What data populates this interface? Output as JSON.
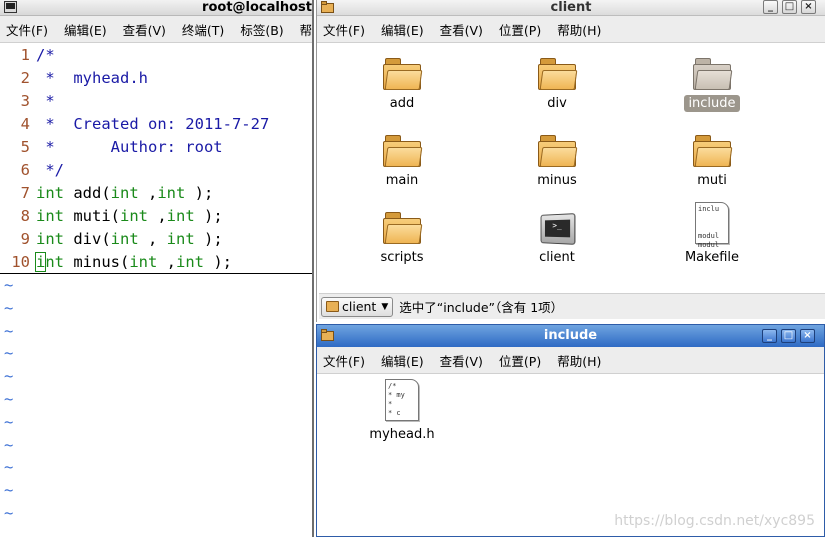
{
  "terminal": {
    "title": "root@localhost",
    "menu": [
      "文件(F)",
      "编辑(E)",
      "查看(V)",
      "终端(T)",
      "标签(B)",
      "帮助"
    ],
    "lines": [
      {
        "num": "1",
        "parts": [
          {
            "c": "cm",
            "t": "/*"
          }
        ]
      },
      {
        "num": "2",
        "parts": [
          {
            "c": "cm",
            "t": " *  myhead.h"
          }
        ]
      },
      {
        "num": "3",
        "parts": [
          {
            "c": "cm",
            "t": " *"
          }
        ]
      },
      {
        "num": "4",
        "parts": [
          {
            "c": "cm",
            "t": " *  Created on: 2011-7-27"
          }
        ]
      },
      {
        "num": "5",
        "parts": [
          {
            "c": "cm",
            "t": " *      Author: root"
          }
        ]
      },
      {
        "num": "6",
        "parts": [
          {
            "c": "cm",
            "t": " */"
          }
        ]
      },
      {
        "num": "7",
        "parts": [
          {
            "c": "kw",
            "t": "int"
          },
          {
            "c": "tx",
            "t": " add("
          },
          {
            "c": "kw",
            "t": "int"
          },
          {
            "c": "tx",
            "t": " ,"
          },
          {
            "c": "kw",
            "t": "int"
          },
          {
            "c": "tx",
            "t": " );"
          }
        ]
      },
      {
        "num": "8",
        "parts": [
          {
            "c": "kw",
            "t": "int"
          },
          {
            "c": "tx",
            "t": " muti("
          },
          {
            "c": "kw",
            "t": "int"
          },
          {
            "c": "tx",
            "t": " ,"
          },
          {
            "c": "kw",
            "t": "int"
          },
          {
            "c": "tx",
            "t": " );"
          }
        ]
      },
      {
        "num": "9",
        "parts": [
          {
            "c": "kw",
            "t": "int"
          },
          {
            "c": "tx",
            "t": " div("
          },
          {
            "c": "kw",
            "t": "int"
          },
          {
            "c": "tx",
            "t": " , "
          },
          {
            "c": "kw",
            "t": "int"
          },
          {
            "c": "tx",
            "t": " );"
          }
        ]
      },
      {
        "num": "10",
        "parts": [
          {
            "c": "kw",
            "t": "int"
          },
          {
            "c": "tx",
            "t": " minus("
          },
          {
            "c": "kw",
            "t": "int"
          },
          {
            "c": "tx",
            "t": " ,"
          },
          {
            "c": "kw",
            "t": "int"
          },
          {
            "c": "tx",
            "t": " );"
          }
        ]
      }
    ],
    "tilde_count": 11,
    "tilde_char": "~"
  },
  "client": {
    "title": "client",
    "menu": [
      "文件(F)",
      "编辑(E)",
      "查看(V)",
      "位置(P)",
      "帮助(H)"
    ],
    "items": [
      {
        "label": "add",
        "kind": "folder"
      },
      {
        "label": "div",
        "kind": "folder"
      },
      {
        "label": "include",
        "kind": "folder",
        "selected": true
      },
      {
        "label": "main",
        "kind": "folder"
      },
      {
        "label": "minus",
        "kind": "folder"
      },
      {
        "label": "muti",
        "kind": "folder"
      },
      {
        "label": "scripts",
        "kind": "folder"
      },
      {
        "label": "client",
        "kind": "executable"
      },
      {
        "label": "Makefile",
        "kind": "text",
        "preview": [
          "inclu",
          "",
          "",
          "modul",
          "modul"
        ]
      }
    ],
    "path_button": "client",
    "status": "选中了“include”（含有 1项）"
  },
  "include": {
    "title": "include",
    "menu": [
      "文件(F)",
      "编辑(E)",
      "查看(V)",
      "位置(P)",
      "帮助(H)"
    ],
    "items": [
      {
        "label": "myhead.h",
        "kind": "text",
        "preview": [
          "/*",
          " * my",
          " *",
          " * c"
        ]
      }
    ]
  },
  "watermark": "https://blog.csdn.net/xyc895"
}
